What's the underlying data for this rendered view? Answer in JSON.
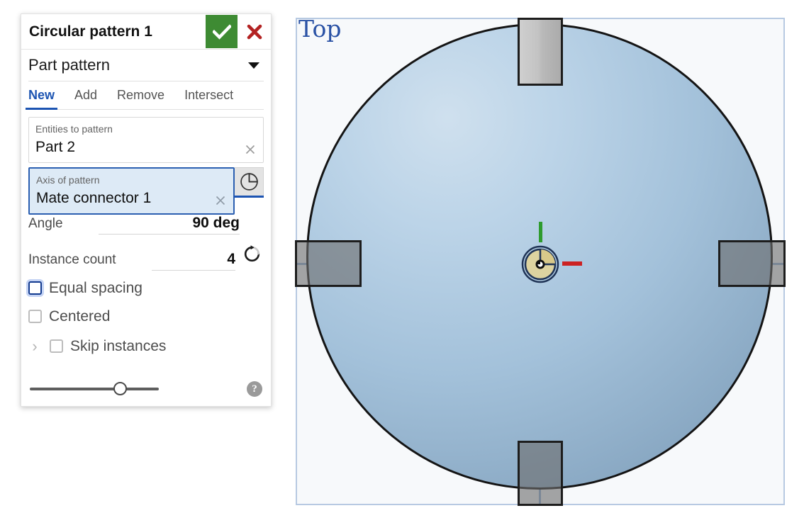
{
  "dialog": {
    "title": "Circular pattern 1",
    "accept_label": "accept-check",
    "cancel_label": "cancel-x",
    "type_selector": {
      "value": "Part pattern",
      "caret": "chevron-down-icon"
    },
    "tabs": [
      {
        "label": "New",
        "active": true
      },
      {
        "label": "Add",
        "active": false
      },
      {
        "label": "Remove",
        "active": false
      },
      {
        "label": "Intersect",
        "active": false
      }
    ],
    "fields": [
      {
        "caption": "Entities to pattern",
        "value": "Part 2",
        "clear": "clear-x-icon",
        "selected": false
      },
      {
        "caption": "Axis of pattern",
        "value": "Mate connector 1",
        "clear": "clear-x-icon",
        "selected": true
      }
    ],
    "axis_tool_icon": "pie-wedge-icon",
    "params": [
      {
        "label": "Angle",
        "value": "90 deg"
      },
      {
        "label": "Instance count",
        "value": "4",
        "extra_icon": "rotate-direction-icon"
      }
    ],
    "checkboxes": [
      {
        "label": "Equal spacing",
        "checked": false,
        "focused": true
      },
      {
        "label": "Centered",
        "checked": false,
        "focused": false
      }
    ],
    "skip": {
      "chevron": "›",
      "label": "Skip instances",
      "checked": false
    },
    "slider": {
      "value_percent": 65
    },
    "help_glyph": "?"
  },
  "viewport": {
    "view_label": "Top",
    "plane_border_color": "#b7c9e2",
    "plane_fill_color": "#f7f9fb",
    "disc_edge_color": "#141414",
    "disc_fill_color": "#a3c1da",
    "axis_line_color": "#8fb0d8",
    "mate_connector": {
      "name": "Mate connector 1",
      "body_color": "#ddd3a0",
      "ring_color": "#1f3355",
      "up_axis_color": "#2e9b2e",
      "right_axis_color": "#cc2222"
    },
    "instances": [
      {
        "name": "pattern-instance-top",
        "style": "opaque"
      },
      {
        "name": "pattern-instance-right",
        "style": "ghost"
      },
      {
        "name": "pattern-instance-bottom",
        "style": "ghost"
      },
      {
        "name": "pattern-instance-left",
        "style": "ghost"
      }
    ]
  }
}
